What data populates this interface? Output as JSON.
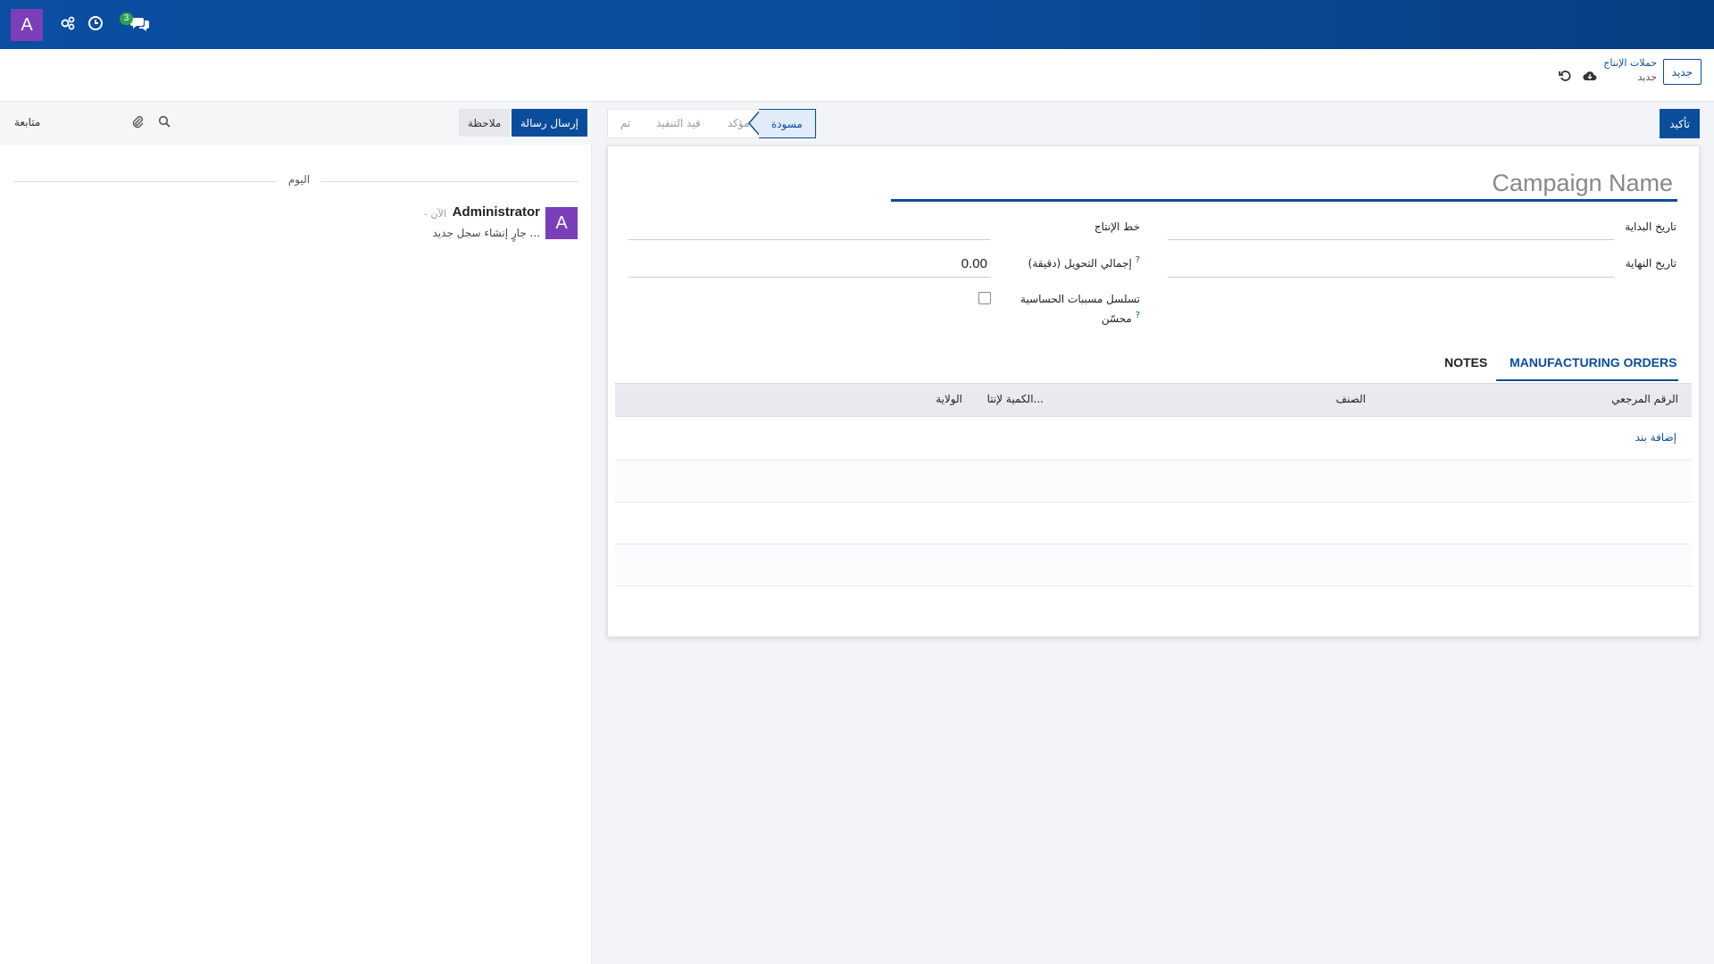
{
  "topbar": {
    "avatar_letter": "A",
    "message_count": "3",
    "colors": {
      "bar": "#0a4d9a",
      "avatar": "#7a3fb8",
      "badge": "#2ea04f"
    }
  },
  "control_panel": {
    "new_button": "جديد",
    "breadcrumb_parent": "حملات الإنتاج",
    "breadcrumb_current": "جديد"
  },
  "chatter": {
    "send_message": "إرسال رسالة",
    "log_note": "ملاحظة",
    "follow": "متابعة",
    "day_separator": "اليوم",
    "message": {
      "author": "Administrator",
      "avatar_letter": "A",
      "date": "- الآن",
      "body": "جارٍ إنشاء سجل جديد ..."
    }
  },
  "statusbar": {
    "confirm_button": "تأكيد",
    "stages": [
      "مسودة",
      "مؤكد",
      "قيد التنفيذ",
      "تم"
    ],
    "current": "مسودة"
  },
  "form": {
    "title_placeholder": "Campaign Name",
    "start_date_label": "تاريخ البداية",
    "end_date_label": "تاريخ النهاية",
    "production_line_label": "خط الإنتاج",
    "total_changeover_label": "إجمالي التحويل (دقيقة)",
    "total_changeover_value": "0.00",
    "optimized_sequence_label_1": "تسلسل مسببات الحساسية",
    "optimized_sequence_label_2": "محسّن",
    "help_mark": "?"
  },
  "tabs": [
    {
      "label": "MANUFACTURING ORDERS",
      "active": true
    },
    {
      "label": "NOTES",
      "active": false
    }
  ],
  "table": {
    "columns": [
      "الرقم المرجعي",
      "الصنف",
      "الكمية لإنتا...",
      "الولاية"
    ],
    "add_line": "إضافة بند"
  }
}
